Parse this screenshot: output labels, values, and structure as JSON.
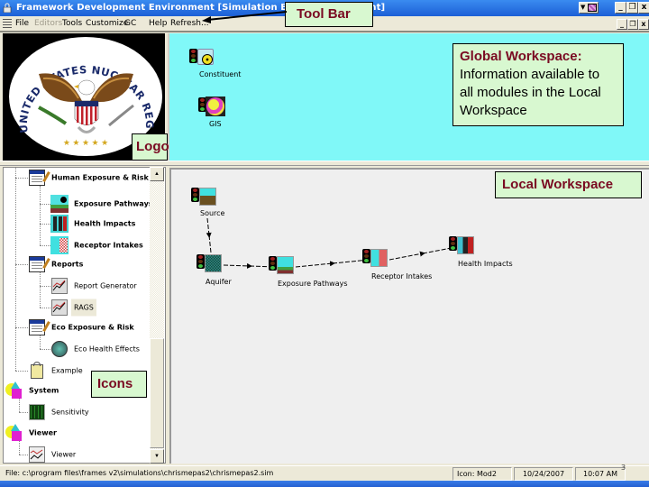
{
  "window": {
    "title": "Framework Development Environment   [Simulation Editor   Environment]",
    "controls": {
      "minimize": "_",
      "restore": "❒",
      "close": "x"
    },
    "mdi_controls": {
      "minimize": "_",
      "restore": "❐",
      "close": "x"
    }
  },
  "menubar": {
    "items": [
      {
        "label": "File",
        "enabled": true
      },
      {
        "label": "Editors",
        "enabled": false
      },
      {
        "label": "Tools",
        "enabled": true
      },
      {
        "label": "Customize",
        "enabled": true
      },
      {
        "label": "GC",
        "enabled": true
      },
      {
        "label": "Help",
        "enabled": true
      },
      {
        "label": "Refresh...",
        "enabled": true
      }
    ]
  },
  "logo": {
    "ring_text": "UNITED STATES NUCLEAR REGULATORY COMMISSION",
    "stars": "★ ★ ★ ★ ★"
  },
  "global_workspace": {
    "modules": [
      {
        "label": "Constituent",
        "icon": "radiation-icon"
      },
      {
        "label": "GIS",
        "icon": "globe-icon"
      }
    ]
  },
  "tree": {
    "items": [
      {
        "label": "Human Exposure & Risk",
        "level": 1,
        "icon": "group-form-icon",
        "bold": true
      },
      {
        "label": "Exposure Pathways",
        "level": 2,
        "icon": "exposure-pathways-icon",
        "bold": true
      },
      {
        "label": "Health Impacts",
        "level": 2,
        "icon": "health-impacts-icon",
        "bold": true
      },
      {
        "label": "Receptor Intakes",
        "level": 2,
        "icon": "receptor-intakes-icon",
        "bold": true
      },
      {
        "label": "Reports",
        "level": 1,
        "icon": "group-form-icon",
        "bold": true
      },
      {
        "label": "Report Generator",
        "level": 2,
        "icon": "chart-icon",
        "bold": false
      },
      {
        "label": "RAGS",
        "level": 2,
        "icon": "chart-icon",
        "bold": false,
        "selected": true
      },
      {
        "label": "Eco Exposure & Risk",
        "level": 1,
        "icon": "group-form-icon",
        "bold": true
      },
      {
        "label": "Eco Health Effects",
        "level": 2,
        "icon": "eco-health-icon",
        "bold": false
      },
      {
        "label": "Example",
        "level": 1,
        "icon": "bag-icon",
        "bold": false
      },
      {
        "label": "System",
        "level": 0,
        "icon": "shapes-icon",
        "bold": true
      },
      {
        "label": "Sensitivity",
        "level": 1,
        "icon": "sensitivity-icon",
        "bold": false
      },
      {
        "label": "Viewer",
        "level": 0,
        "icon": "shapes-icon",
        "bold": true
      },
      {
        "label": "Viewer",
        "level": 1,
        "icon": "viewer-chart-icon",
        "bold": false
      }
    ]
  },
  "local_workspace": {
    "nodes": [
      {
        "id": "source",
        "label": "Source"
      },
      {
        "id": "aquifer",
        "label": "Aquifer"
      },
      {
        "id": "exposure",
        "label": "Exposure Pathways"
      },
      {
        "id": "receptor",
        "label": "Receptor Intakes"
      },
      {
        "id": "health",
        "label": "Health Impacts"
      }
    ],
    "connections": [
      [
        "source",
        "aquifer"
      ],
      [
        "aquifer",
        "exposure"
      ],
      [
        "exposure",
        "receptor"
      ],
      [
        "receptor",
        "health"
      ]
    ]
  },
  "callouts": {
    "tool_bar": "Tool Bar",
    "logo": "Logo",
    "global_title": "Global Workspace:",
    "global_body": "Information available to all modules in the Local Workspace",
    "local": "Local Workspace",
    "icons": "Icons"
  },
  "statusbar": {
    "file": "File: c:\\program files\\frames v2\\simulations\\chrismepas2\\chrismepas2.sim",
    "icon": "Icon: Mod2",
    "date": "10/24/2007",
    "time": "10:07 AM"
  },
  "slide_number": "3",
  "colors": {
    "global_bg": "#80f8f8",
    "callout_bg": "#d8f8d0",
    "callout_title": "#7a0a22",
    "titlebar": "#2a6fe0"
  }
}
